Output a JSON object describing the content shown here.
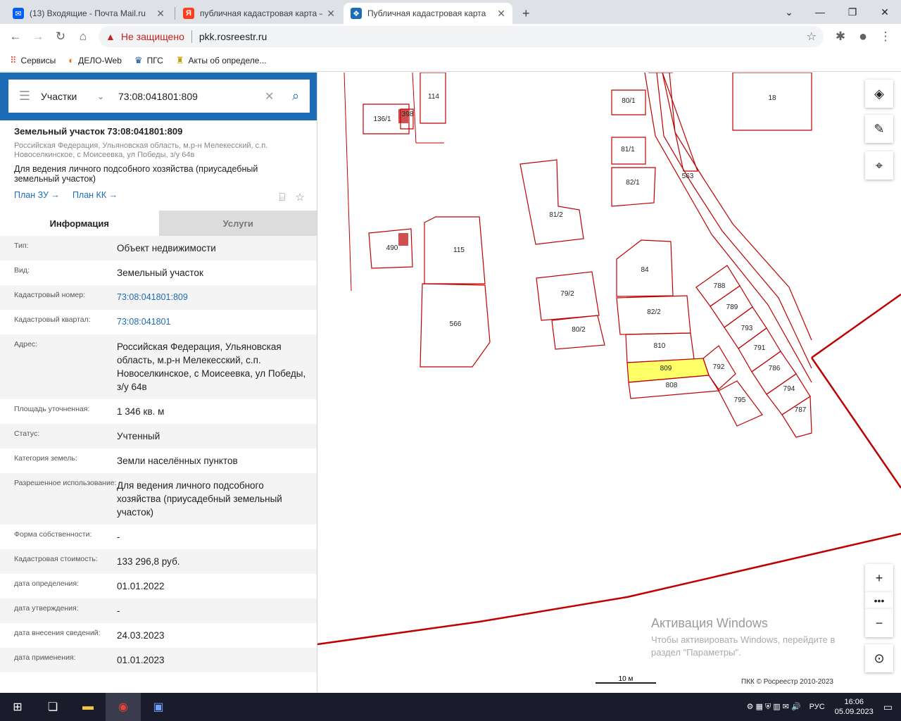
{
  "browser": {
    "tabs": [
      {
        "title": "(13) Входящие - Почта Mail.ru",
        "favicon": "mail-icon",
        "color": "#005ff9"
      },
      {
        "title": "публичная кадастровая карта — ",
        "favicon": "yandex-icon",
        "color": "#fc3f1d"
      },
      {
        "title": "Публичная кадастровая карта",
        "favicon": "rosreestr-icon",
        "color": "#1d6cb5"
      }
    ],
    "new_tab": "+",
    "security_label": "Не защищено",
    "url": "pkk.rosreestr.ru",
    "bookmarks": [
      "Сервисы",
      "ДЕЛО-Web",
      "ПГС",
      "Акты об определе..."
    ]
  },
  "search": {
    "category": "Участки",
    "query": "73:08:041801:809"
  },
  "object": {
    "title": "Земельный участок 73:08:041801:809",
    "address": "Российская Федерация, Ульяновская область, м.р-н Мелекесский, с.п. Новоселкинское, с Моисеевка, ул Победы, з/у 64в",
    "use": "Для ведения личного подсобного хозяйства (приусадебный земельный участок)",
    "link_plan_zu": "План ЗУ →",
    "link_plan_kk": "План КК →"
  },
  "tabs": {
    "info": "Информация",
    "services": "Услуги"
  },
  "rows": [
    {
      "label": "Тип:",
      "value": "Объект недвижимости"
    },
    {
      "label": "Вид:",
      "value": "Земельный участок"
    },
    {
      "label": "Кадастровый номер:",
      "value": "73:08:041801:809",
      "link": true
    },
    {
      "label": "Кадастровый квартал:",
      "value": "73:08:041801",
      "link": true
    },
    {
      "label": "Адрес:",
      "value": "Российская Федерация, Ульяновская область, м.р-н Мелекесский, с.п. Новоселкинское, с Моисеевка, ул Победы, з/у 64в"
    },
    {
      "label": "Площадь уточненная:",
      "value": "1 346 кв. м"
    },
    {
      "label": "Статус:",
      "value": "Учтенный"
    },
    {
      "label": "Категория земель:",
      "value": "Земли населённых пунктов"
    },
    {
      "label": "Разрешенное использование:",
      "value": "Для ведения личного подсобного хозяйства (приусадебный земельный участок)"
    },
    {
      "label": "Форма собственности:",
      "value": "-"
    },
    {
      "label": "Кадастровая стоимость:",
      "value": "133 296,8 руб."
    },
    {
      "label": "дата определения:",
      "value": "01.01.2022"
    },
    {
      "label": "дата утверждения:",
      "value": "-"
    },
    {
      "label": "дата внесения сведений:",
      "value": "24.03.2023"
    },
    {
      "label": "дата применения:",
      "value": "01.01.2023"
    }
  ],
  "map": {
    "parcel_labels": [
      "136/1",
      "398",
      "114",
      "80/1",
      "18",
      "81/1",
      "82/1",
      "563",
      "81/2",
      "490",
      "115",
      "84",
      "788",
      "789",
      "82/2",
      "793",
      "79/2",
      "80/2",
      "566",
      "810",
      "791",
      "809",
      "792",
      "786",
      "808",
      "794",
      "795",
      "787"
    ],
    "line_color": "#c00000",
    "highlight_color": "#ffff66",
    "scale_label": "10 м",
    "copyright": "ПКК © Росреестр 2010-2023",
    "activation_title": "Активация Windows",
    "activation_text": "Чтобы активировать Windows, перейдите в раздел \"Параметры\"."
  },
  "taskbar": {
    "lang": "РУС",
    "time": "16:06",
    "date": "05.09.2023"
  }
}
